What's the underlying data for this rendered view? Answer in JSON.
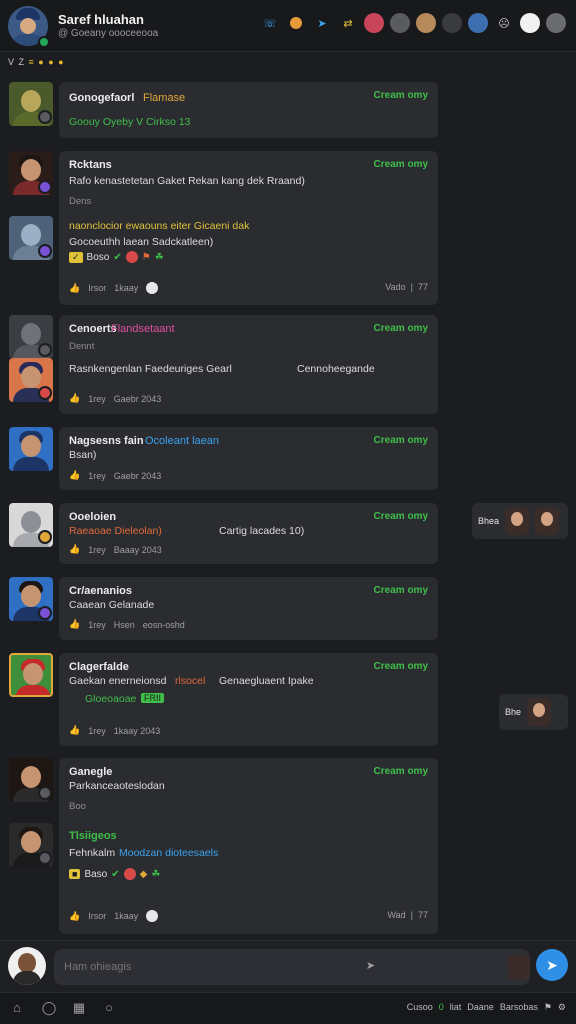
{
  "header": {
    "title": "Saref hluahan",
    "subtitle": "@ Goeany oooceeooa",
    "icons": [
      "phone-icon",
      "emoji-icon",
      "pin-icon",
      "shuffle-icon",
      "avatar",
      "avatar",
      "avatar",
      "avatar",
      "avatar",
      "emoji-icon",
      "avatar"
    ]
  },
  "strip": {
    "text": "V Z",
    "dots": "≡ ● ● ●"
  },
  "posts": [
    {
      "name": "Gonogefaorl",
      "highlight": "Flamase",
      "highlight_color": "#e0a83a",
      "time": "Cream omy",
      "line1": "Goouy  Oyeby  V  Cirkso 13",
      "line1_color": "#3fbf4a"
    },
    {
      "name": "Rcktans",
      "time": "Cream omy",
      "line1": "Rafo kenastetetan Gaket Rekan kang dek Rraand)",
      "muted": "Dens",
      "line2": "naonclocior   ewaouns eiter Gicaeni dak",
      "line3": "Gocoeuthh laean Sadckatleen)",
      "reacts": "Boso",
      "meta1": "Irsor",
      "meta2": "1kaay",
      "count1": "Vado",
      "count2": "77"
    },
    {
      "name": "Cenoerts",
      "highlight": "Flandsetaant",
      "highlight_color": "#e04fa0",
      "time": "Cream omy",
      "muted": "Dennt",
      "line1": "Rasnkengenlan Faedeuriges Gearl",
      "line1b": "Cennoheegande",
      "meta1": "1rey",
      "meta2": "Gaebr 2043"
    },
    {
      "name": "Nagsesns fain",
      "highlight": "Ocoleant laean",
      "highlight_color": "#3aa3ef",
      "time": "Cream omy",
      "line1": "Bsan)",
      "meta1": "1rey",
      "meta2": "Gaebr 2043"
    },
    {
      "name": "Ooeloien",
      "time": "Cream omy",
      "line1": "Raeaoae Dieleolan)",
      "line1b": "Cartig lacades 10)",
      "meta1": "1rey",
      "meta2": "Baaay 2043"
    },
    {
      "name": "Cr/aenanios",
      "time": "Cream omy",
      "line1": "Caaean Gelanade",
      "meta1": "1rey",
      "meta2": "Hsen",
      "meta3": "eosn-oshd"
    },
    {
      "name": "Clagerfalde",
      "time": "Cream omy",
      "line1": "Gaekan enerneionsd",
      "line1_hl": "rlsocel",
      "line1c": "Genaegluaent Ipake",
      "line2": "Gloeoaoae",
      "chip": "FRII",
      "meta1": "1rey",
      "meta2": "1kaay 2043"
    },
    {
      "name": "Ganegle",
      "time": "Cream omy",
      "line1": "Parkanceaoteslodan",
      "muted": "Boo",
      "name2": "Tlsiigeos",
      "line2": "Fehnkalm",
      "line2_hl": "Moodzan dioteesaels",
      "reacts": "Baso",
      "meta1": "Irsor",
      "meta2": "1kaay",
      "count1": "Wad",
      "count2": "77"
    }
  ],
  "side_popups": [
    {
      "label": "Bhea"
    },
    {
      "label": "Bhe"
    }
  ],
  "composer": {
    "placeholder": "Ham ohieagis"
  },
  "tabbar": {
    "right_text_1": "Cusoo",
    "right_green": "0",
    "right_text_2": "liat",
    "right_text_3": "Daane",
    "right_text_4": "Barsobas"
  },
  "colors": {
    "accent_green": "#3fbf4a",
    "send_blue": "#2f8fe6",
    "card_bg": "#2b2c30",
    "page_bg": "#1c1d20"
  }
}
